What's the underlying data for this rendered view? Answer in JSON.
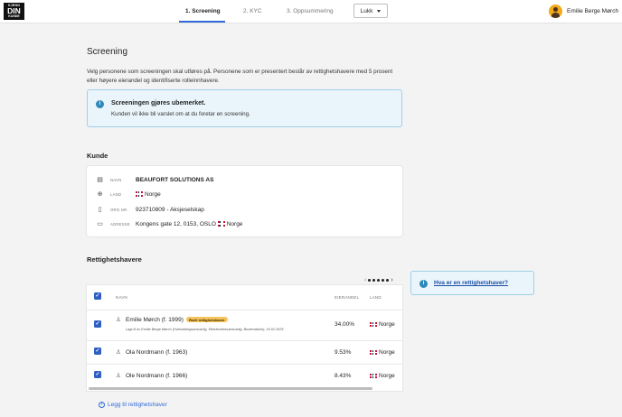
{
  "header": {
    "logo": {
      "line1": "KJENN",
      "line2": "DIN",
      "line3": "KUNDE"
    },
    "tabs": [
      {
        "label": "1. Screening",
        "active": true
      },
      {
        "label": "2. KYC",
        "active": false
      },
      {
        "label": "3. Oppsummering",
        "active": false
      }
    ],
    "close_label": "Lukk",
    "user_name": "Emilie Berge Mørch"
  },
  "main": {
    "title": "Screening",
    "intro": "Velg personene som screeningen skal utføres på. Personene som er presentert består av rettighetshavere med 5 prosent eller høyere eierandel og identifiserte rolleinnhavere.",
    "info": {
      "icon": "info-icon",
      "title": "Screeningen gjøres ubemerket.",
      "text": "Kunden vil ikke bli varslet om at du foretar en screening."
    }
  },
  "kunde": {
    "heading": "Kunde",
    "rows": [
      {
        "icon": "building-icon",
        "label": "Navn",
        "value": "BEAUFORT SOLUTIONS AS",
        "flag": false
      },
      {
        "icon": "globe-icon",
        "label": "Land",
        "value": "Norge",
        "flag": true
      },
      {
        "icon": "document-icon",
        "label": "Org.nr.",
        "value": "923710809 - Aksjeselskap",
        "flag": false
      },
      {
        "icon": "address-icon",
        "label": "Adresse",
        "value": "Kongens gate 12, 0153, OSLO",
        "suffix": "Norge",
        "flag": false
      }
    ]
  },
  "rettighetshavere": {
    "heading": "Rettighetshavere",
    "columns": {
      "name": "Navn",
      "share": "Eierandel",
      "country": "Land"
    },
    "rows": [
      {
        "name": "Emilie Mørch (f. 1999)",
        "badge": "Reell rettighetshaver",
        "note": "Lagt til av Emilie Berge Mørch (Hvitvaskingsansvarlig, Etterlevelsesansvarlig, Brukeradmin), 16.02.2025",
        "share": "34.00%",
        "country": "Norge",
        "checked": true
      },
      {
        "name": "Ola Nordmann (f. 1963)",
        "badge": "",
        "note": "",
        "share": "9.53%",
        "country": "Norge",
        "checked": true
      },
      {
        "name": "Ole Nordmann (f. 1966)",
        "badge": "",
        "note": "",
        "share": "8.43%",
        "country": "Norge",
        "checked": true
      }
    ],
    "add_label": "Legg til rettighetshaver"
  },
  "side": {
    "help_link": "Hva er en rettighetshaver?"
  },
  "colors": {
    "accent": "#2f6ad8",
    "info_bg": "#eaf5fb",
    "badge": "#f7c35c",
    "checkbox": "#2f5fc2"
  }
}
